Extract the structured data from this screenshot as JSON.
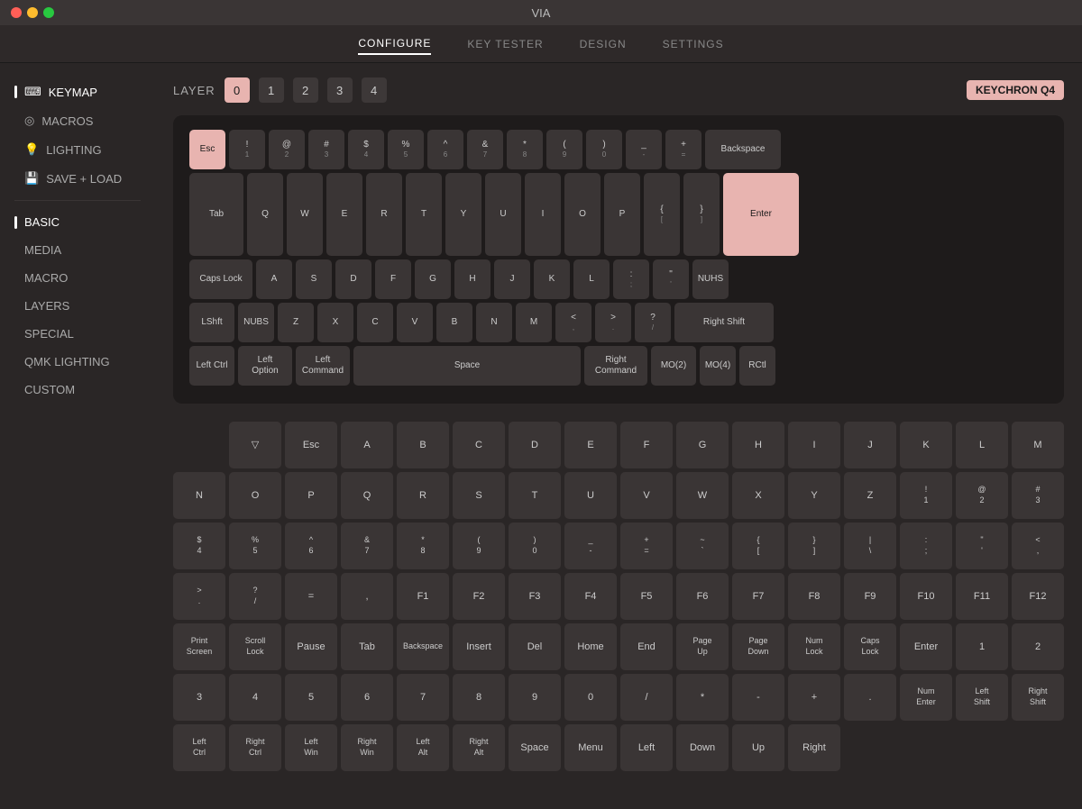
{
  "titlebar": {
    "title": "VIA"
  },
  "nav": {
    "items": [
      {
        "label": "CONFIGURE",
        "active": true
      },
      {
        "label": "KEY TESTER",
        "active": false
      },
      {
        "label": "DESIGN",
        "active": false
      },
      {
        "label": "SETTINGS",
        "active": false
      }
    ]
  },
  "sidebar_top": {
    "items": [
      {
        "id": "keymap",
        "label": "KEYMAP",
        "icon": "keyboard",
        "active": true
      },
      {
        "id": "macros",
        "label": "MACROS",
        "icon": "circle"
      },
      {
        "id": "lighting",
        "label": "LIGHTING",
        "icon": "bulb"
      },
      {
        "id": "save-load",
        "label": "SAVE + LOAD",
        "icon": "save"
      }
    ]
  },
  "sidebar_bottom": {
    "items": [
      {
        "id": "basic",
        "label": "BASIC",
        "active": true
      },
      {
        "id": "media",
        "label": "MEDIA"
      },
      {
        "id": "macro",
        "label": "MACRO"
      },
      {
        "id": "layers",
        "label": "LAYERS"
      },
      {
        "id": "special",
        "label": "SPECIAL"
      },
      {
        "id": "qmk-lighting",
        "label": "QMK LIGHTING"
      },
      {
        "id": "custom",
        "label": "CUSTOM"
      }
    ]
  },
  "keyboard": {
    "badge": "KEYCHRON Q4",
    "layer_label": "LAYER",
    "layers": [
      "0",
      "1",
      "2",
      "3",
      "4"
    ],
    "active_layer": 0,
    "rows": [
      [
        {
          "label": "Esc",
          "w": "w-1",
          "pink": true
        },
        {
          "label": "!",
          "sub": "1",
          "w": "w-1"
        },
        {
          "label": "@",
          "sub": "2",
          "w": "w-1"
        },
        {
          "label": "#",
          "sub": "3",
          "w": "w-1"
        },
        {
          "label": "$",
          "sub": "4",
          "w": "w-1"
        },
        {
          "label": "%",
          "sub": "5",
          "w": "w-1"
        },
        {
          "label": "^",
          "sub": "6",
          "w": "w-1"
        },
        {
          "label": "&",
          "sub": "7",
          "w": "w-1"
        },
        {
          "label": "*",
          "sub": "8",
          "w": "w-1"
        },
        {
          "label": "(",
          "sub": "9",
          "w": "w-1"
        },
        {
          "label": ")",
          "sub": "0",
          "w": "w-1"
        },
        {
          "label": "_",
          "sub": "-",
          "w": "w-1"
        },
        {
          "label": "+",
          "sub": "=",
          "w": "w-1"
        },
        {
          "label": "Backspace",
          "w": "w-2"
        }
      ],
      [
        {
          "label": "Tab",
          "w": "w-15"
        },
        {
          "label": "Q",
          "w": "w-1"
        },
        {
          "label": "W",
          "w": "w-1"
        },
        {
          "label": "E",
          "w": "w-1"
        },
        {
          "label": "R",
          "w": "w-1"
        },
        {
          "label": "T",
          "w": "w-1"
        },
        {
          "label": "Y",
          "w": "w-1"
        },
        {
          "label": "U",
          "w": "w-1"
        },
        {
          "label": "I",
          "w": "w-1"
        },
        {
          "label": "O",
          "w": "w-1"
        },
        {
          "label": "P",
          "w": "w-1"
        },
        {
          "label": "{",
          "sub": "[",
          "w": "w-1"
        },
        {
          "label": "}",
          "sub": "]",
          "w": "w-1"
        },
        {
          "label": "Enter",
          "w": "w-2",
          "pink": true,
          "enter": true
        }
      ],
      [
        {
          "label": "Caps Lock",
          "w": "w-175"
        },
        {
          "label": "A",
          "w": "w-1"
        },
        {
          "label": "S",
          "w": "w-1"
        },
        {
          "label": "D",
          "w": "w-1"
        },
        {
          "label": "F",
          "w": "w-1"
        },
        {
          "label": "G",
          "w": "w-1"
        },
        {
          "label": "H",
          "w": "w-1"
        },
        {
          "label": "J",
          "w": "w-1"
        },
        {
          "label": "K",
          "w": "w-1"
        },
        {
          "label": "L",
          "w": "w-1"
        },
        {
          "label": ":",
          "sub": ";",
          "w": "w-1"
        },
        {
          "label": "\"",
          "sub": "'",
          "w": "w-1"
        },
        {
          "label": "NUHS",
          "w": "w-1"
        }
      ],
      [
        {
          "label": "LShft",
          "w": "w-125"
        },
        {
          "label": "NUBS",
          "w": "w-1"
        },
        {
          "label": "Z",
          "w": "w-1"
        },
        {
          "label": "X",
          "w": "w-1"
        },
        {
          "label": "C",
          "w": "w-1"
        },
        {
          "label": "V",
          "w": "w-1"
        },
        {
          "label": "B",
          "w": "w-1"
        },
        {
          "label": "N",
          "w": "w-1"
        },
        {
          "label": "M",
          "w": "w-1"
        },
        {
          "label": "<",
          "sub": ",",
          "w": "w-1"
        },
        {
          "label": ">",
          "sub": ".",
          "w": "w-1"
        },
        {
          "label": "?",
          "sub": "/",
          "w": "w-1"
        },
        {
          "label": "Right Shift",
          "w": "w-275"
        }
      ],
      [
        {
          "label": "Left Ctrl",
          "w": "w-125"
        },
        {
          "label": "Left\nOption",
          "w": "w-15"
        },
        {
          "label": "Left\nCommand",
          "w": "w-15"
        },
        {
          "label": "Space",
          "w": "w-6"
        },
        {
          "label": "Right\nCommand",
          "w": "w-175"
        },
        {
          "label": "MO(2)",
          "w": "w-125"
        },
        {
          "label": "MO(4)",
          "w": "w-1"
        },
        {
          "label": "RCtl",
          "w": "w-1"
        }
      ]
    ]
  },
  "picker": {
    "sections": [
      {
        "id": "basic",
        "label": "BASIC",
        "active": true
      },
      {
        "id": "media",
        "label": "MEDIA"
      },
      {
        "id": "macro",
        "label": "MACRO"
      },
      {
        "id": "layers",
        "label": "LAYERS"
      },
      {
        "id": "special",
        "label": "SPECIAL"
      },
      {
        "id": "qmk-lighting",
        "label": "QMK LIGHTING"
      },
      {
        "id": "custom",
        "label": "CUSTOM"
      }
    ],
    "rows": [
      [
        {
          "label": "",
          "empty": true
        },
        {
          "label": "▽"
        },
        {
          "label": "Esc"
        },
        {
          "label": "A"
        },
        {
          "label": "B"
        },
        {
          "label": "C"
        },
        {
          "label": "D"
        },
        {
          "label": "E"
        },
        {
          "label": "F"
        },
        {
          "label": "G"
        },
        {
          "label": "H"
        },
        {
          "label": "I"
        },
        {
          "label": "J"
        },
        {
          "label": "K"
        },
        {
          "label": "L"
        },
        {
          "label": "M"
        }
      ],
      [
        {
          "label": "N"
        },
        {
          "label": "O"
        },
        {
          "label": "P"
        },
        {
          "label": "Q"
        },
        {
          "label": "R"
        },
        {
          "label": "S"
        },
        {
          "label": "T"
        },
        {
          "label": "U"
        },
        {
          "label": "V"
        },
        {
          "label": "W"
        },
        {
          "label": "X"
        },
        {
          "label": "Y"
        },
        {
          "label": "Z"
        },
        {
          "label": "!\n1"
        },
        {
          "label": "@\n2"
        },
        {
          "label": "#\n3"
        }
      ],
      [
        {
          "label": "$\n4"
        },
        {
          "label": "%\n5"
        },
        {
          "label": "^\n6"
        },
        {
          "label": "&\n7"
        },
        {
          "label": "*\n8"
        },
        {
          "label": "(\n9"
        },
        {
          "label": ")\n0"
        },
        {
          "label": "_\n-"
        },
        {
          "label": "+\n="
        },
        {
          "label": "~\n`"
        },
        {
          "label": "{\n["
        },
        {
          "label": "}\n]"
        },
        {
          "label": "|\n\\"
        },
        {
          "label": ":\n;"
        },
        {
          "label": "\"\n'"
        },
        {
          "label": "<\n,"
        }
      ],
      [
        {
          "label": ">\n."
        },
        {
          "label": "?\n/"
        },
        {
          "label": "="
        },
        {
          "label": ","
        },
        {
          "label": "F1"
        },
        {
          "label": "F2"
        },
        {
          "label": "F3"
        },
        {
          "label": "F4"
        },
        {
          "label": "F5"
        },
        {
          "label": "F6"
        },
        {
          "label": "F7"
        },
        {
          "label": "F8"
        },
        {
          "label": "F9"
        },
        {
          "label": "F10"
        },
        {
          "label": "F11"
        },
        {
          "label": "F12"
        }
      ],
      [
        {
          "label": "Print\nScreen"
        },
        {
          "label": "Scroll\nLock"
        },
        {
          "label": "Pause"
        },
        {
          "label": "Tab"
        },
        {
          "label": "Backspace"
        },
        {
          "label": "Insert"
        },
        {
          "label": "Del"
        },
        {
          "label": "Home"
        },
        {
          "label": "End"
        },
        {
          "label": "Page\nUp"
        },
        {
          "label": "Page\nDown"
        },
        {
          "label": "Num\nLock"
        },
        {
          "label": "Caps\nLock"
        },
        {
          "label": "Enter"
        },
        {
          "label": "1"
        },
        {
          "label": "2"
        }
      ],
      [
        {
          "label": "3"
        },
        {
          "label": "4"
        },
        {
          "label": "5"
        },
        {
          "label": "6"
        },
        {
          "label": "7"
        },
        {
          "label": "8"
        },
        {
          "label": "9"
        },
        {
          "label": "0"
        },
        {
          "label": "/"
        },
        {
          "label": "*"
        },
        {
          "label": "-"
        },
        {
          "label": "+"
        },
        {
          "label": "."
        },
        {
          "label": "Num\nEnter"
        },
        {
          "label": "Left\nShift"
        },
        {
          "label": "Right\nShift"
        }
      ],
      [
        {
          "label": "Left\nCtrl"
        },
        {
          "label": "Right\nCtrl"
        },
        {
          "label": "Left\nWin"
        },
        {
          "label": "Right\nWin"
        },
        {
          "label": "Left\nAlt"
        },
        {
          "label": "Right\nAlt"
        },
        {
          "label": "Space"
        },
        {
          "label": "Menu"
        },
        {
          "label": "Left"
        },
        {
          "label": "Down"
        },
        {
          "label": "Up"
        },
        {
          "label": "Right"
        },
        {
          "label": "",
          "empty": true
        },
        {
          "label": "",
          "empty": true
        },
        {
          "label": "",
          "empty": true
        },
        {
          "label": "",
          "empty": true
        }
      ]
    ]
  }
}
